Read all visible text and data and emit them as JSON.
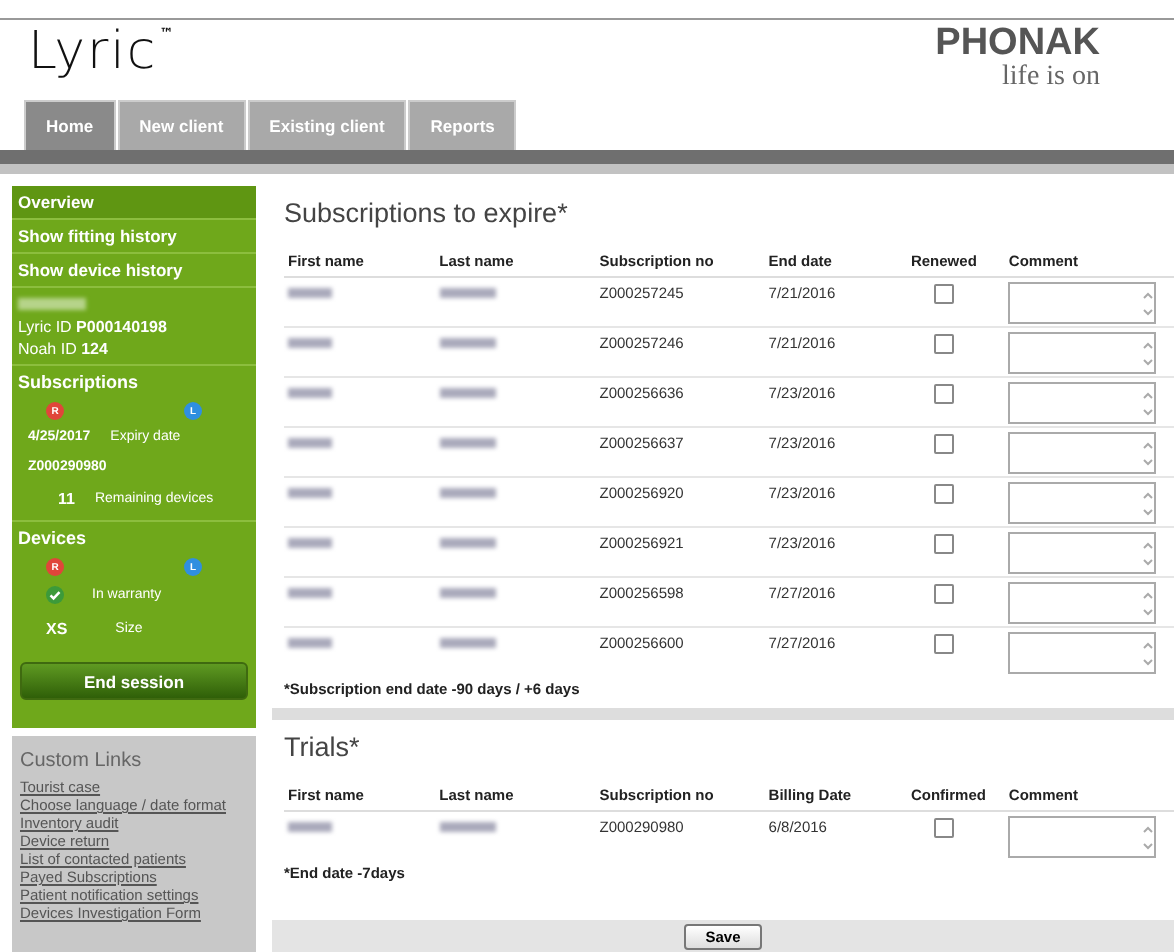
{
  "header": {
    "product_logo": "Lyric",
    "trademark": "™",
    "brand_logo": "PHONAK",
    "tagline": "life is on"
  },
  "tabs": [
    {
      "label": "Home",
      "selected": true
    },
    {
      "label": "New client",
      "selected": false
    },
    {
      "label": "Existing client",
      "selected": false
    },
    {
      "label": "Reports",
      "selected": false
    }
  ],
  "sidebar": {
    "nav": [
      {
        "label": "Overview",
        "selected": true
      },
      {
        "label": "Show fitting history",
        "selected": false
      },
      {
        "label": "Show device history",
        "selected": false
      }
    ],
    "client": {
      "lyric_id_label": "Lyric ID",
      "lyric_id": "P000140198",
      "noah_id_label": "Noah ID",
      "noah_id": "124"
    },
    "subscriptions": {
      "title": "Subscriptions",
      "right_badge": "R",
      "left_badge": "L",
      "expiry": "4/25/2017",
      "expiry_label": "Expiry date",
      "number": "Z000290980",
      "remaining": "11",
      "remaining_label": "Remaining devices"
    },
    "devices": {
      "title": "Devices",
      "right_badge": "R",
      "left_badge": "L",
      "warranty_label": "In warranty",
      "in_warranty": true,
      "size": "XS",
      "size_label": "Size"
    },
    "end_session": "End session"
  },
  "custom_links": {
    "title": "Custom Links",
    "links": [
      "Tourist case",
      "Choose language / date format",
      "Inventory audit",
      "Device return",
      "List of contacted patients",
      "Payed Subscriptions",
      "Patient notification settings",
      "Devices Investigation Form"
    ]
  },
  "subscriptions_to_expire": {
    "title": "Subscriptions to expire*",
    "columns": [
      "First name",
      "Last name",
      "Subscription no",
      "End date",
      "Renewed",
      "Comment"
    ],
    "rows": [
      {
        "subscription_no": "Z000257245",
        "end_date": "7/21/2016",
        "checked": false
      },
      {
        "subscription_no": "Z000257246",
        "end_date": "7/21/2016",
        "checked": false
      },
      {
        "subscription_no": "Z000256636",
        "end_date": "7/23/2016",
        "checked": false
      },
      {
        "subscription_no": "Z000256637",
        "end_date": "7/23/2016",
        "checked": false
      },
      {
        "subscription_no": "Z000256920",
        "end_date": "7/23/2016",
        "checked": false
      },
      {
        "subscription_no": "Z000256921",
        "end_date": "7/23/2016",
        "checked": false
      },
      {
        "subscription_no": "Z000256598",
        "end_date": "7/27/2016",
        "checked": false
      },
      {
        "subscription_no": "Z000256600",
        "end_date": "7/27/2016",
        "checked": false
      }
    ],
    "footnote": "*Subscription end date -90 days / +6 days"
  },
  "trials": {
    "title": "Trials*",
    "columns": [
      "First name",
      "Last name",
      "Subscription no",
      "Billing Date",
      "Confirmed",
      "Comment"
    ],
    "rows": [
      {
        "subscription_no": "Z000290980",
        "end_date": "6/8/2016",
        "checked": false
      }
    ],
    "footnote": "*End date -7days"
  },
  "save_button": "Save"
}
